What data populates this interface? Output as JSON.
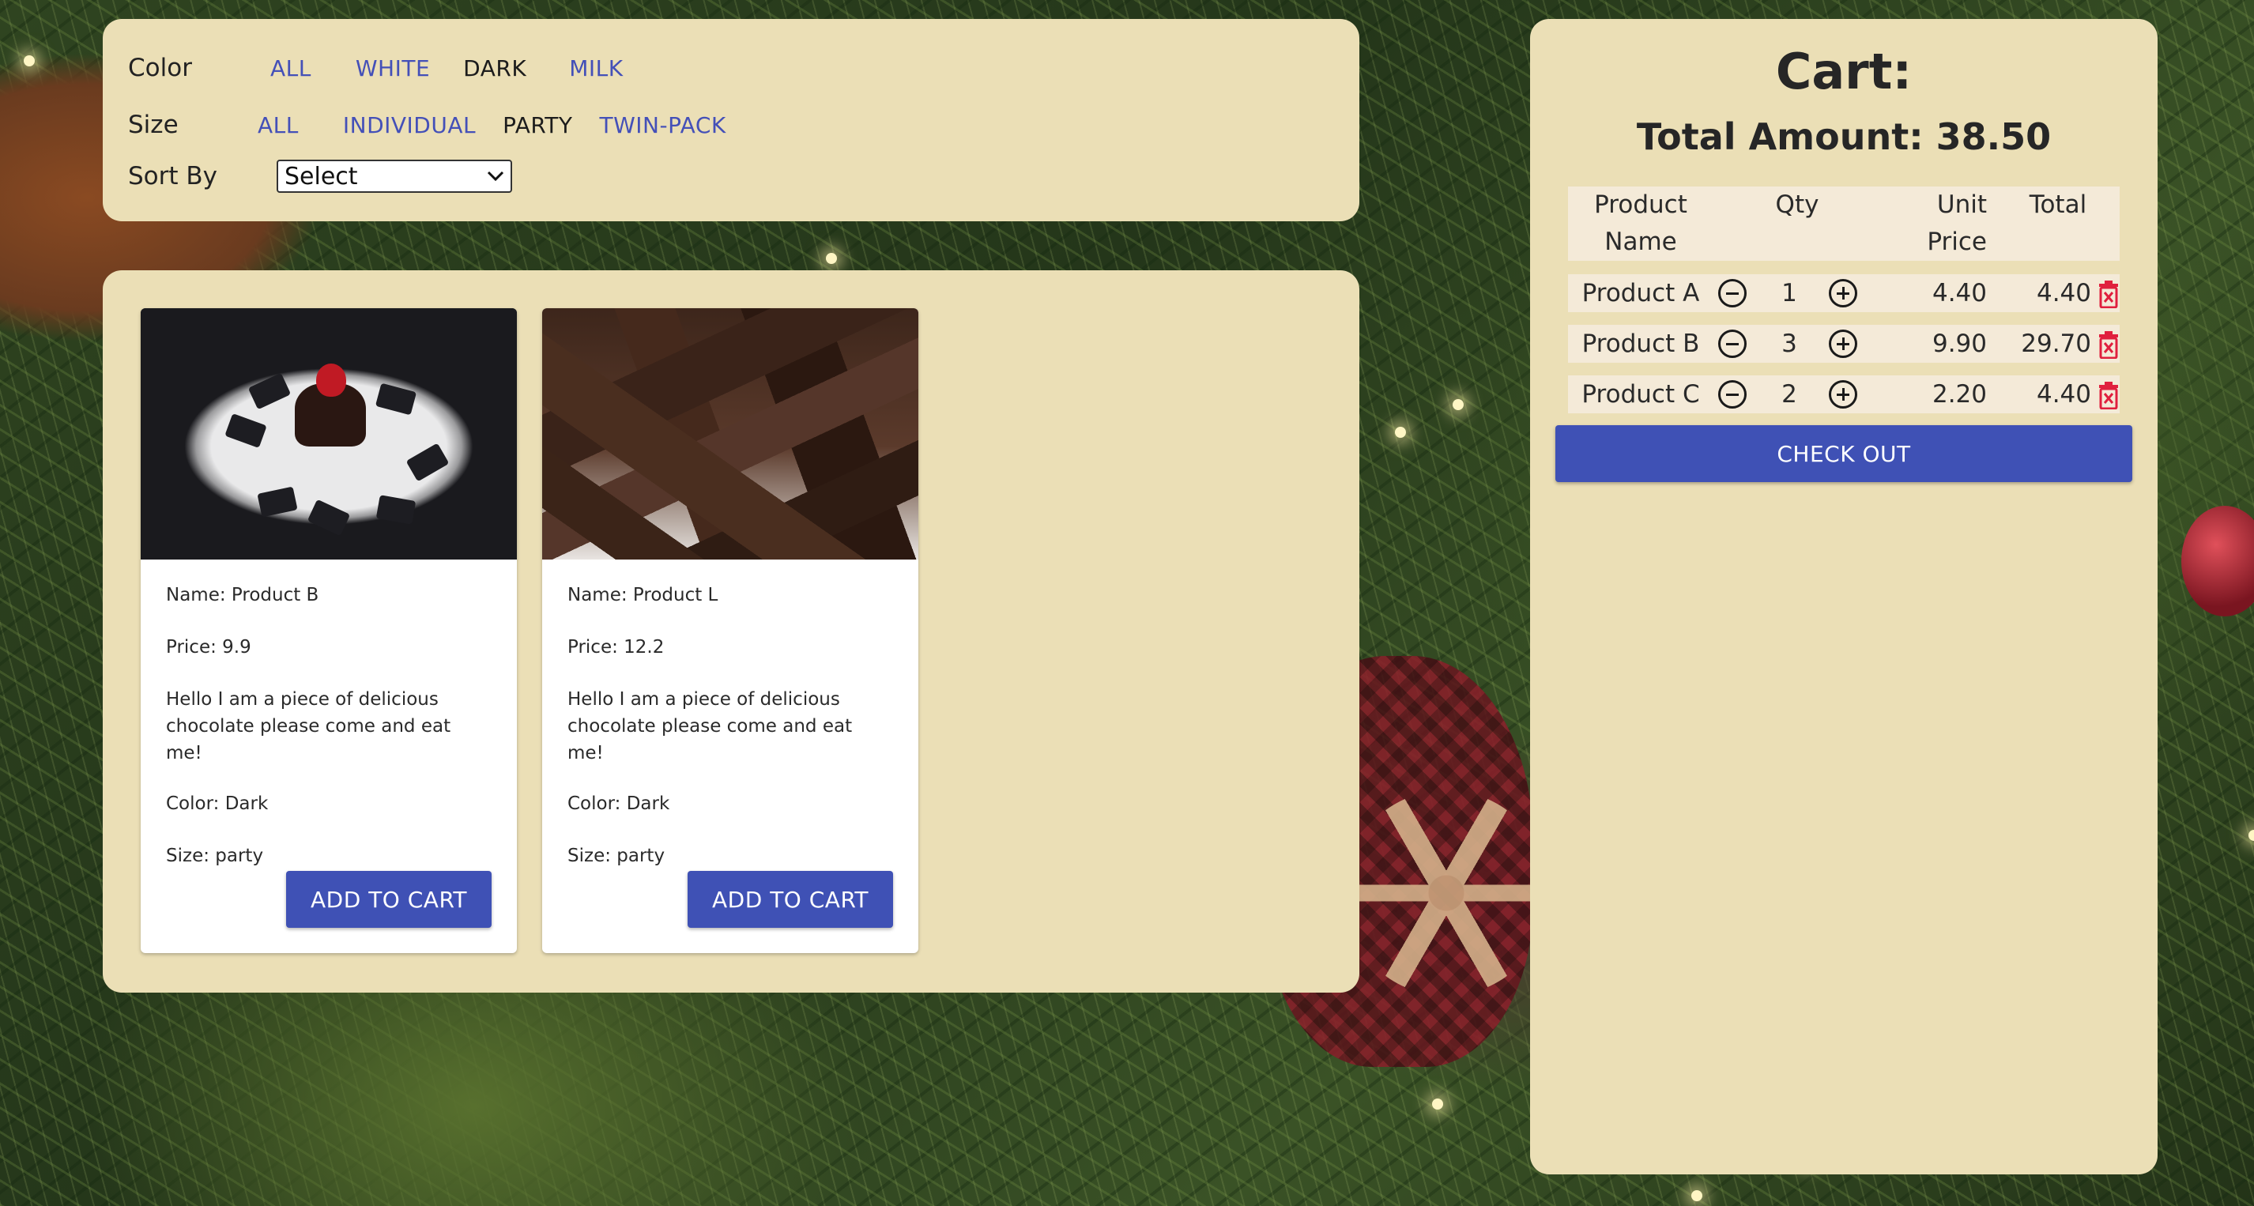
{
  "filters": {
    "color": {
      "label": "Color",
      "options": [
        "ALL",
        "WHITE",
        "DARK",
        "MILK"
      ],
      "selected": "DARK"
    },
    "size": {
      "label": "Size",
      "options": [
        "ALL",
        "INDIVIDUAL",
        "PARTY",
        "TWIN-PACK"
      ],
      "selected": "PARTY"
    },
    "sort": {
      "label": "Sort By",
      "value": "Select"
    },
    "colors": {
      "link": "#4450b8",
      "selected": "#1c1c1c"
    }
  },
  "products": [
    {
      "name": "Name: Product B",
      "price": "Price: 9.9",
      "description": "Hello I am a piece of delicious chocolate please come and eat me!",
      "color": "Color: Dark",
      "size": "Size: party",
      "button": "ADD TO CART",
      "image_icon": "chocolate-cake-plate-image"
    },
    {
      "name": "Name: Product L",
      "price": "Price: 12.2",
      "description": "Hello I am a piece of delicious chocolate please come and eat me!",
      "color": "Color: Dark",
      "size": "Size: party",
      "button": "ADD TO CART",
      "image_icon": "chocolate-chunks-image"
    }
  ],
  "cart": {
    "title": "Cart:",
    "total": "Total Amount: 38.50",
    "headers": {
      "name_line1": "Product",
      "name_line2": "Name",
      "qty": "Qty",
      "unit_line1": "Unit",
      "unit_line2": "Price",
      "total": "Total"
    },
    "items": [
      {
        "name": "Product A",
        "qty": "1",
        "unit": "4.40",
        "total": "4.40"
      },
      {
        "name": "Product B",
        "qty": "3",
        "unit": "9.90",
        "total": "29.70"
      },
      {
        "name": "Product C",
        "qty": "2",
        "unit": "2.20",
        "total": "4.40"
      }
    ],
    "checkout": "CHECK OUT",
    "icons": {
      "decrease": "minus-circle-icon",
      "increase": "plus-circle-icon",
      "remove": "trash-icon"
    },
    "colors": {
      "accent": "#3f51b5",
      "delete": "#e0203e",
      "panel": "#ebdfb6"
    }
  }
}
